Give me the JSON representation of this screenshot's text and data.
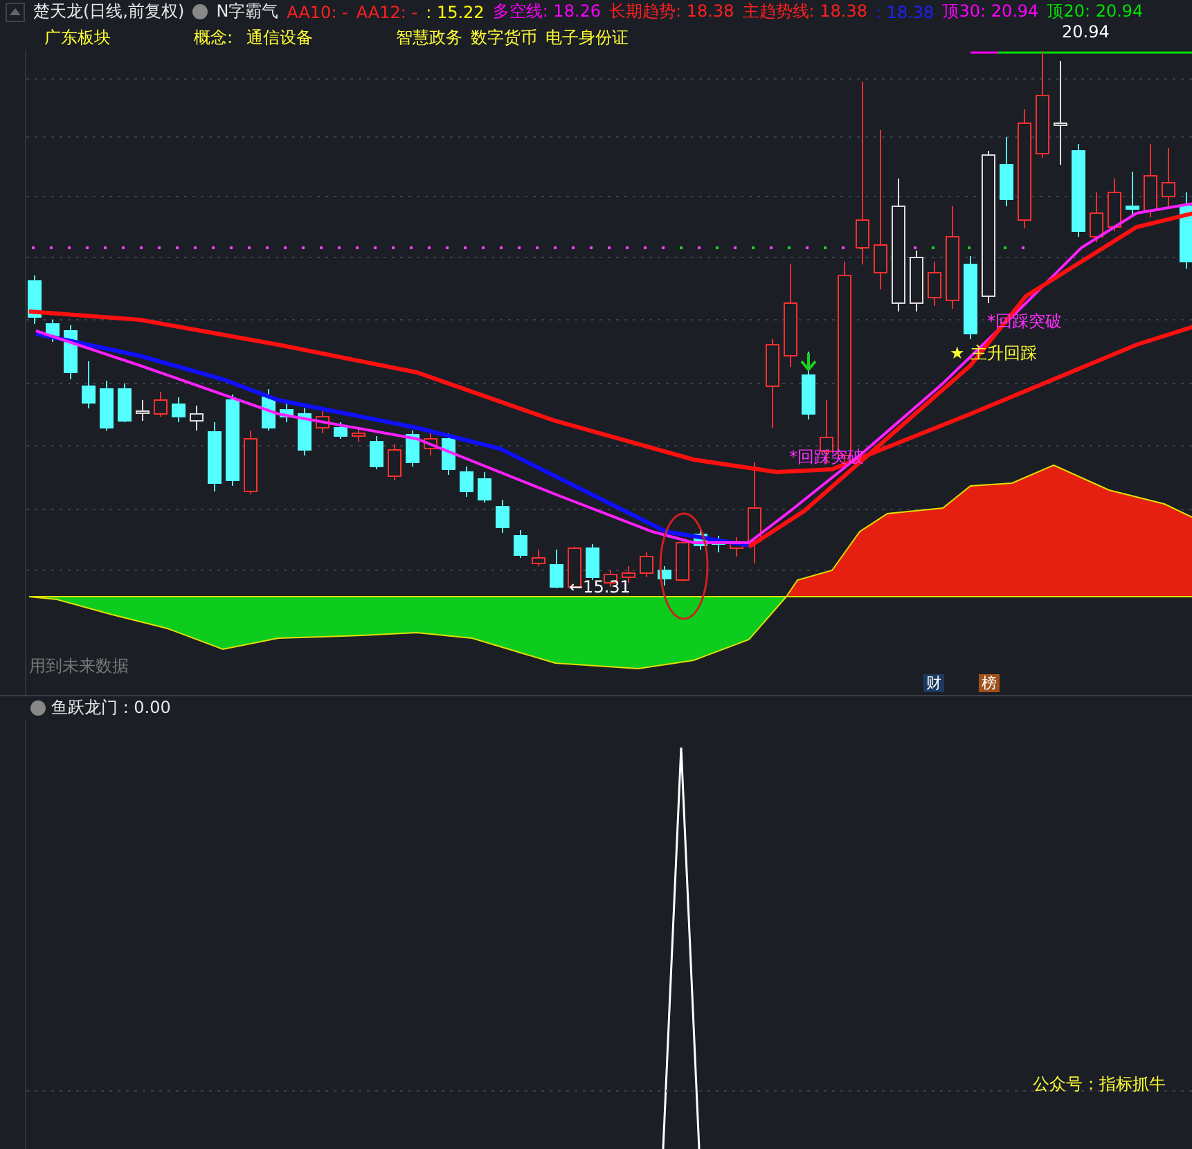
{
  "header": {
    "title": "楚天龙(日线,前复权)",
    "indicator": "N字霸气"
  },
  "legend": [
    {
      "label": "AA10: -",
      "color": "#ff2020"
    },
    {
      "label": "AA12: -",
      "color": "#ff2020"
    },
    {
      "label": ": 15.22",
      "color": "#ffff00"
    },
    {
      "label": "多空线: 18.26",
      "color": "#ff00ff"
    },
    {
      "label": "长期趋势: 18.38",
      "color": "#ff2020"
    },
    {
      "label": "主趋势线: 18.38",
      "color": "#ff2020"
    },
    {
      "label": ": 18.38",
      "color": "#2020ff"
    },
    {
      "label": "顶30: 20.94",
      "color": "#ff00ff"
    },
    {
      "label": "顶20: 20.94",
      "color": "#00e000"
    }
  ],
  "concepts": {
    "sector": "广东板块",
    "label": "概念:",
    "tags": [
      "通信设备",
      "智慧政务",
      "数字货币",
      "电子身份证"
    ]
  },
  "annotations": {
    "high": "20.94",
    "low": "←15.31",
    "breakout_left": "*回踩突破",
    "breakout_right": "*回踩突破",
    "main_rise": "主升回踩",
    "star": "★",
    "future_note": "用到未来数据",
    "badges": [
      "财",
      "榜"
    ]
  },
  "sub_panel": {
    "title": "鱼跃龙门 : 0.00",
    "footer": "公众号：指标抓牛"
  }
}
